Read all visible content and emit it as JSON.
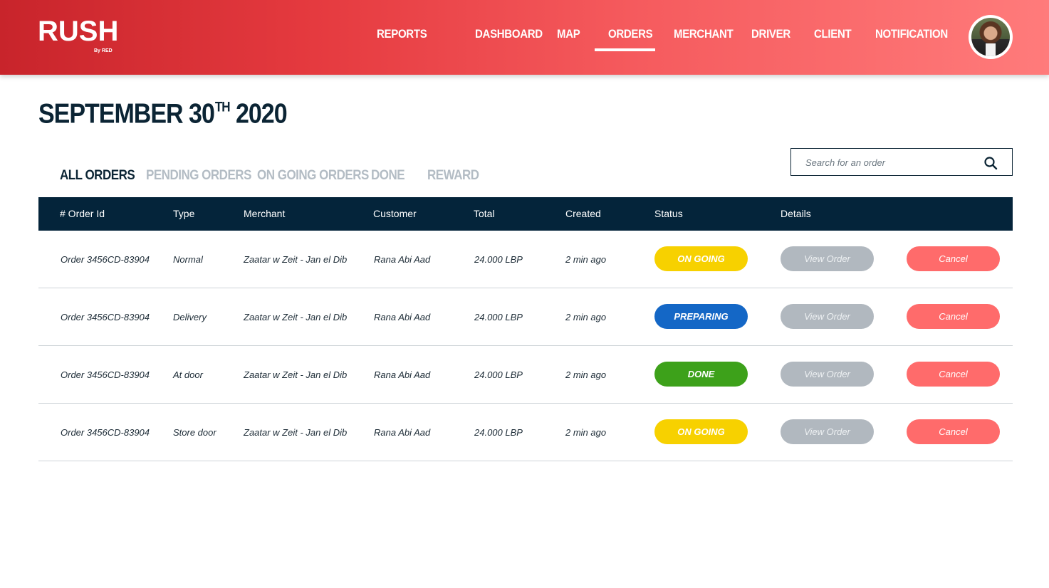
{
  "brand": {
    "name": "RUSH",
    "sub": "By RED",
    "gradient_start": "#c8242b",
    "gradient_end": "#ff7b7b"
  },
  "nav": {
    "items": [
      {
        "label": "REPORTS"
      },
      {
        "label": "DASHBOARD"
      },
      {
        "label": "MAP"
      },
      {
        "label": "ORDERS",
        "active": true
      },
      {
        "label": "MERCHANT"
      },
      {
        "label": "DRIVER"
      },
      {
        "label": "CLIENT"
      },
      {
        "label": "NOTIFICATION"
      }
    ]
  },
  "page": {
    "title_main": "SEPTEMBER 30",
    "title_sup": "TH",
    "title_year": " 2020"
  },
  "tabs": [
    {
      "label": "ALL ORDERS",
      "active": true
    },
    {
      "label": "PENDING ORDERS"
    },
    {
      "label": "ON GOING ORDERS"
    },
    {
      "label": "DONE"
    },
    {
      "label": "REWARD"
    }
  ],
  "search": {
    "placeholder": "Search for an order",
    "icon": "search-icon"
  },
  "table": {
    "header_color": "#04243a",
    "columns": [
      "# Order Id",
      "Type",
      "Merchant",
      "Customer",
      "Total",
      "Created",
      "Status",
      "Details"
    ],
    "rows": [
      {
        "order_id": "Order 3456CD-83904",
        "type": "Normal",
        "merchant": "Zaatar w Zeit - Jan el Dib",
        "customer": "Rana Abi Aad",
        "total": "24.000 LBP",
        "created": "2 min ago",
        "status": "ON GOING",
        "status_color": "#f7d100",
        "view": "View Order",
        "cancel": "Cancel"
      },
      {
        "order_id": "Order 3456CD-83904",
        "type": "Delivery",
        "merchant": "Zaatar w Zeit - Jan el Dib",
        "customer": "Rana Abi Aad",
        "total": "24.000 LBP",
        "created": "2 min ago",
        "status": "PREPARING",
        "status_color": "#1467c6",
        "view": "View Order",
        "cancel": "Cancel"
      },
      {
        "order_id": "Order 3456CD-83904",
        "type": "At door",
        "merchant": "Zaatar w Zeit - Jan el Dib",
        "customer": "Rana Abi Aad",
        "total": "24.000 LBP",
        "created": "2 min ago",
        "status": "DONE",
        "status_color": "#3da11a",
        "view": "View Order",
        "cancel": "Cancel"
      },
      {
        "order_id": "Order 3456CD-83904",
        "type": "Store door",
        "merchant": "Zaatar w Zeit - Jan el Dib",
        "customer": "Rana Abi Aad",
        "total": "24.000 LBP",
        "created": "2 min ago",
        "status": "ON GOING",
        "status_color": "#f7d100",
        "view": "View Order",
        "cancel": "Cancel"
      }
    ]
  },
  "colors": {
    "view_button": "#b1b8bf",
    "cancel_button": "#ff6b6b",
    "text_dark": "#0b2434"
  }
}
